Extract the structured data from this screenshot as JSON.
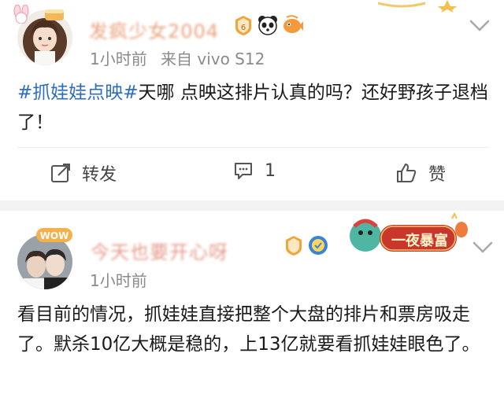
{
  "post1": {
    "username": "发疯少女2004",
    "time": "1小时前",
    "source": "来自 vivo S12",
    "topic": "#抓娃娃点映#",
    "text": "天哪 点映这排片认真的吗？还好野孩子退档了！",
    "actions": {
      "repost_label": "转发",
      "comment_count": "1",
      "like_label": "赞"
    },
    "level_badge": "6"
  },
  "post2": {
    "username": "今天也要开心呀",
    "time": "1小时前",
    "text": "看目前的情况，抓娃娃直接把整个大盘的排片和票房吸走了。默杀10亿大概是稳的，上13亿就要看抓娃娃眼色了。",
    "sticker_text": "一夜暴富",
    "avatar_tag": "WOW"
  },
  "colors": {
    "topic": "#2e6dbd",
    "meta": "#8a8a8a",
    "sticker_red": "#c9372c"
  }
}
